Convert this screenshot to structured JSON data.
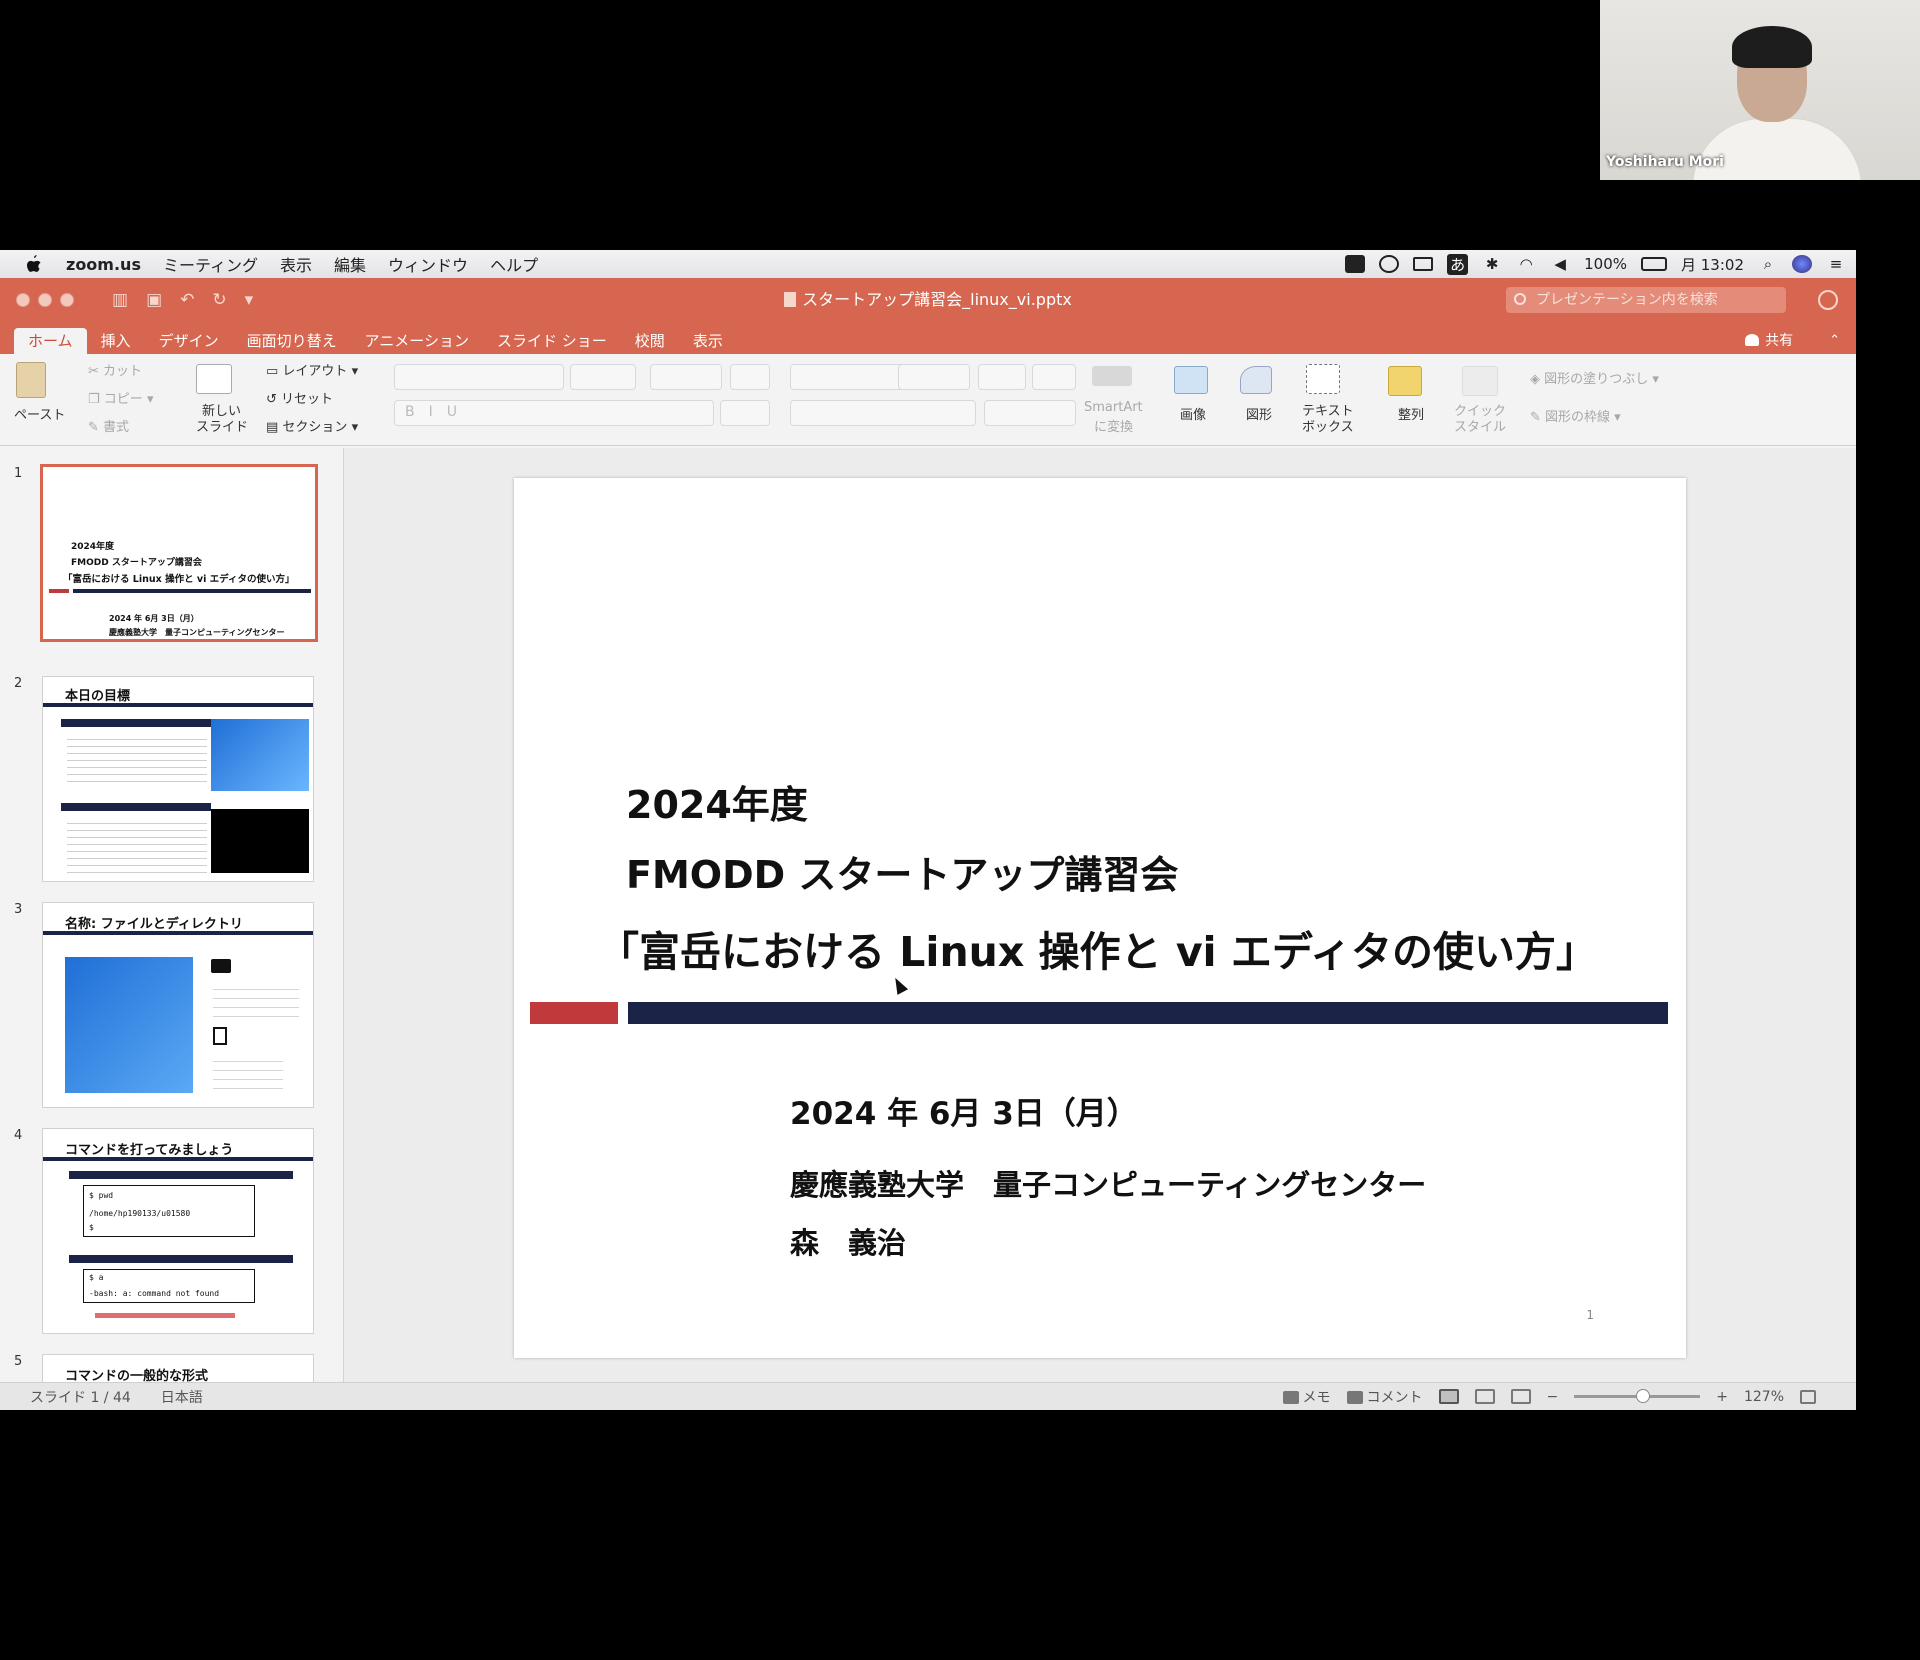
{
  "participant": {
    "name": "Yoshiharu Mori"
  },
  "menubar": {
    "app": "zoom.us",
    "items": [
      "ミーティング",
      "表示",
      "編集",
      "ウィンドウ",
      "ヘルプ"
    ],
    "ime": "あ",
    "battery": "100%",
    "clock": "月 13:02"
  },
  "window": {
    "doc_title": "スタートアップ講習会_linux_vi.pptx",
    "search_placeholder": "プレゼンテーション内を検索",
    "tabs": [
      "ホーム",
      "挿入",
      "デザイン",
      "画面切り替え",
      "アニメーション",
      "スライド ショー",
      "校閲",
      "表示"
    ],
    "share": "共有"
  },
  "ribbon": {
    "paste": "ペースト",
    "cut": "カット",
    "copy": "コピー",
    "format": "書式",
    "new_slide_1": "新しい",
    "new_slide_2": "スライド",
    "layout": "レイアウト",
    "reset": "リセット",
    "section": "セクション",
    "smartart_1": "SmartArt",
    "smartart_2": "に変換",
    "image": "画像",
    "shapes": "図形",
    "textbox_1": "テキスト",
    "textbox_2": "ボックス",
    "arrange": "整列",
    "quickstyle_1": "クイック",
    "quickstyle_2": "スタイル",
    "shape_fill": "図形の塗りつぶし",
    "shape_outline": "図形の枠線"
  },
  "thumbnails": {
    "numbers": [
      "1",
      "2",
      "3",
      "4",
      "5"
    ],
    "s1": {
      "l1": "2024年度",
      "l2": "FMODD スタートアップ講習会",
      "l3": "「富岳における Linux 操作と vi エディタの使い方」",
      "l4": "2024 年 6月 3日（月）",
      "l5": "慶應義塾大学　量子コンピューティングセンター",
      "l6": "森　義治"
    },
    "s2": {
      "title": "本日の目標"
    },
    "s3": {
      "title": "名称: ファイルとディレクトリ"
    },
    "s4": {
      "title": "コマンドを打ってみましょう",
      "cmd1": "$ pwd",
      "out1": "/home/hp190133/u01580",
      "prompt": "$",
      "cmd2": "$ a",
      "out2": "-bash: a: command not found"
    },
    "s5": {
      "title": "コマンドの一般的な形式"
    }
  },
  "slide": {
    "line1": "2024年度",
    "line2": "FMODD スタートアップ講習会",
    "line3": "「富岳における Linux 操作と vi エディタの使い方」",
    "date": "2024 年 6月 3日（月）",
    "affiliation": "慶應義塾大学　量子コンピューティングセンター",
    "author": "森　義治",
    "page": "1"
  },
  "statusbar": {
    "slide_counter": "スライド 1 / 44",
    "language": "日本語",
    "notes": "メモ",
    "comments": "コメント",
    "zoom": "127%"
  },
  "colors": {
    "accent": "#d6664f",
    "slide_navy": "#1b2347",
    "slide_red": "#c0393b"
  }
}
